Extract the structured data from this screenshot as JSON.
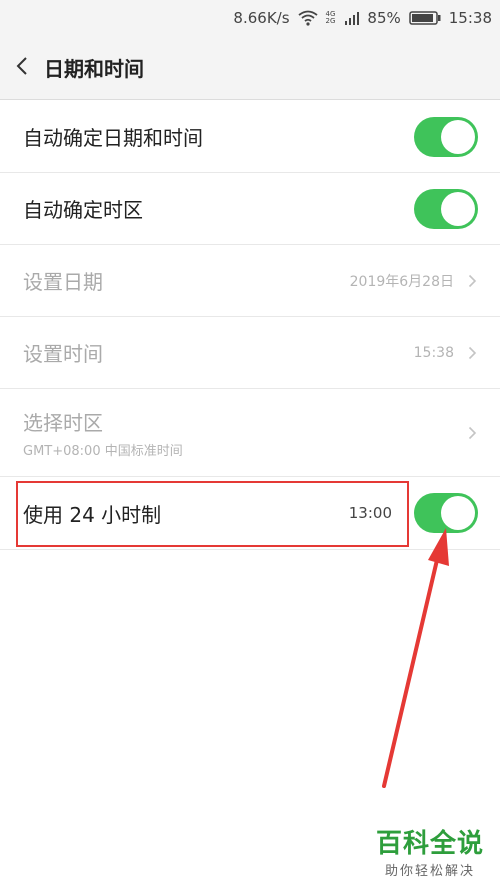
{
  "status_bar": {
    "speed": "8.66K/s",
    "net_top": "4G",
    "net_bottom": "2G",
    "battery": "85%",
    "time": "15:38"
  },
  "header": {
    "title": "日期和时间"
  },
  "rows": {
    "auto_datetime": {
      "label": "自动确定日期和时间",
      "enabled": true
    },
    "auto_timezone": {
      "label": "自动确定时区",
      "enabled": true
    },
    "set_date": {
      "label": "设置日期",
      "value": "2019年6月28日"
    },
    "set_time": {
      "label": "设置时间",
      "value": "15:38"
    },
    "timezone": {
      "label": "选择时区",
      "sub": "GMT+08:00 中国标准时间"
    },
    "use_24h": {
      "label": "使用 24 小时制",
      "value": "13:00",
      "enabled": true
    }
  },
  "watermark": {
    "title": "百科全说",
    "subtitle": "助你轻松解决"
  },
  "colors": {
    "toggle_on": "#3fc35a",
    "highlight": "#e53935",
    "watermark": "#2e9e3c"
  }
}
